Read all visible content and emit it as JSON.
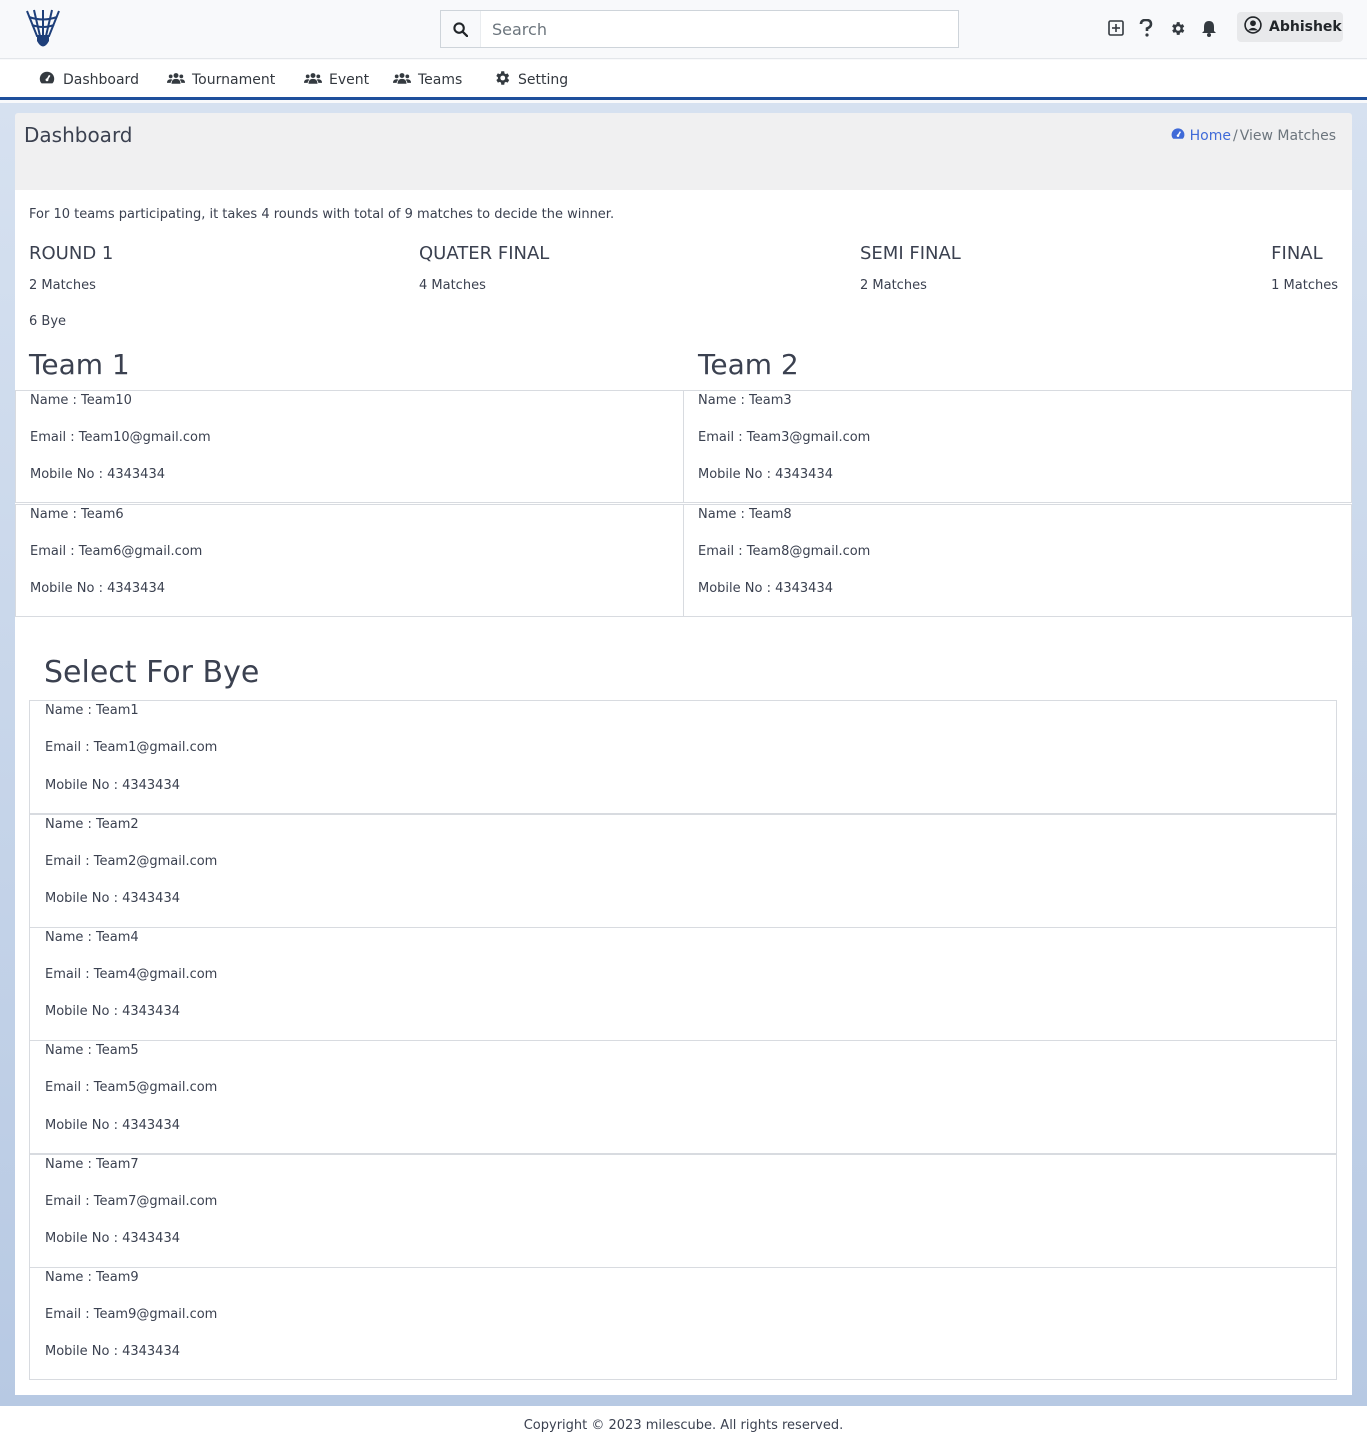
{
  "search": {
    "placeholder": "Search"
  },
  "user": {
    "name": "Abhishek"
  },
  "nav": [
    {
      "label": "Dashboard",
      "icon": "dashboard-gauge-icon"
    },
    {
      "label": "Tournament",
      "icon": "users-icon"
    },
    {
      "label": "Event",
      "icon": "users-icon"
    },
    {
      "label": "Teams",
      "icon": "users-icon"
    },
    {
      "label": "Setting",
      "icon": "gear-icon"
    }
  ],
  "page": {
    "title": "Dashboard",
    "breadcrumb": {
      "home": "Home",
      "separator": "/",
      "current": "View Matches"
    }
  },
  "info": "For 10 teams participating, it takes 4 rounds with total of 9 matches to decide the winner.",
  "rounds": [
    {
      "title": "ROUND 1",
      "count": "2 Matches"
    },
    {
      "title": "QUATER FINAL",
      "count": "4 Matches"
    },
    {
      "title": "SEMI FINAL",
      "count": "2 Matches"
    },
    {
      "title": "FINAL",
      "count": "1 Matches"
    }
  ],
  "bye_count": "6 Bye",
  "team_columns": [
    "Team 1",
    "Team 2"
  ],
  "matches": [
    {
      "team1": {
        "name": "Name : Team10",
        "email": "Email : Team10@gmail.com",
        "mobile": "Mobile No : 4343434"
      },
      "team2": {
        "name": "Name : Team3",
        "email": "Email : Team3@gmail.com",
        "mobile": "Mobile No : 4343434"
      }
    },
    {
      "team1": {
        "name": "Name : Team6",
        "email": "Email : Team6@gmail.com",
        "mobile": "Mobile No : 4343434"
      },
      "team2": {
        "name": "Name : Team8",
        "email": "Email : Team8@gmail.com",
        "mobile": "Mobile No : 4343434"
      }
    }
  ],
  "bye_title": "Select For Bye",
  "bye_teams": [
    {
      "name": "Name : Team1",
      "email": "Email : Team1@gmail.com",
      "mobile": "Mobile No : 4343434"
    },
    {
      "name": "Name : Team2",
      "email": "Email : Team2@gmail.com",
      "mobile": "Mobile No : 4343434"
    },
    {
      "name": "Name : Team4",
      "email": "Email : Team4@gmail.com",
      "mobile": "Mobile No : 4343434"
    },
    {
      "name": "Name : Team5",
      "email": "Email : Team5@gmail.com",
      "mobile": "Mobile No : 4343434"
    },
    {
      "name": "Name : Team7",
      "email": "Email : Team7@gmail.com",
      "mobile": "Mobile No : 4343434"
    },
    {
      "name": "Name : Team9",
      "email": "Email : Team9@gmail.com",
      "mobile": "Mobile No : 4343434"
    }
  ],
  "footer": "Copyright © 2023 milescube. All rights reserved.",
  "colors": {
    "accent": "#1e4f9c",
    "link": "#3f6ad8"
  }
}
